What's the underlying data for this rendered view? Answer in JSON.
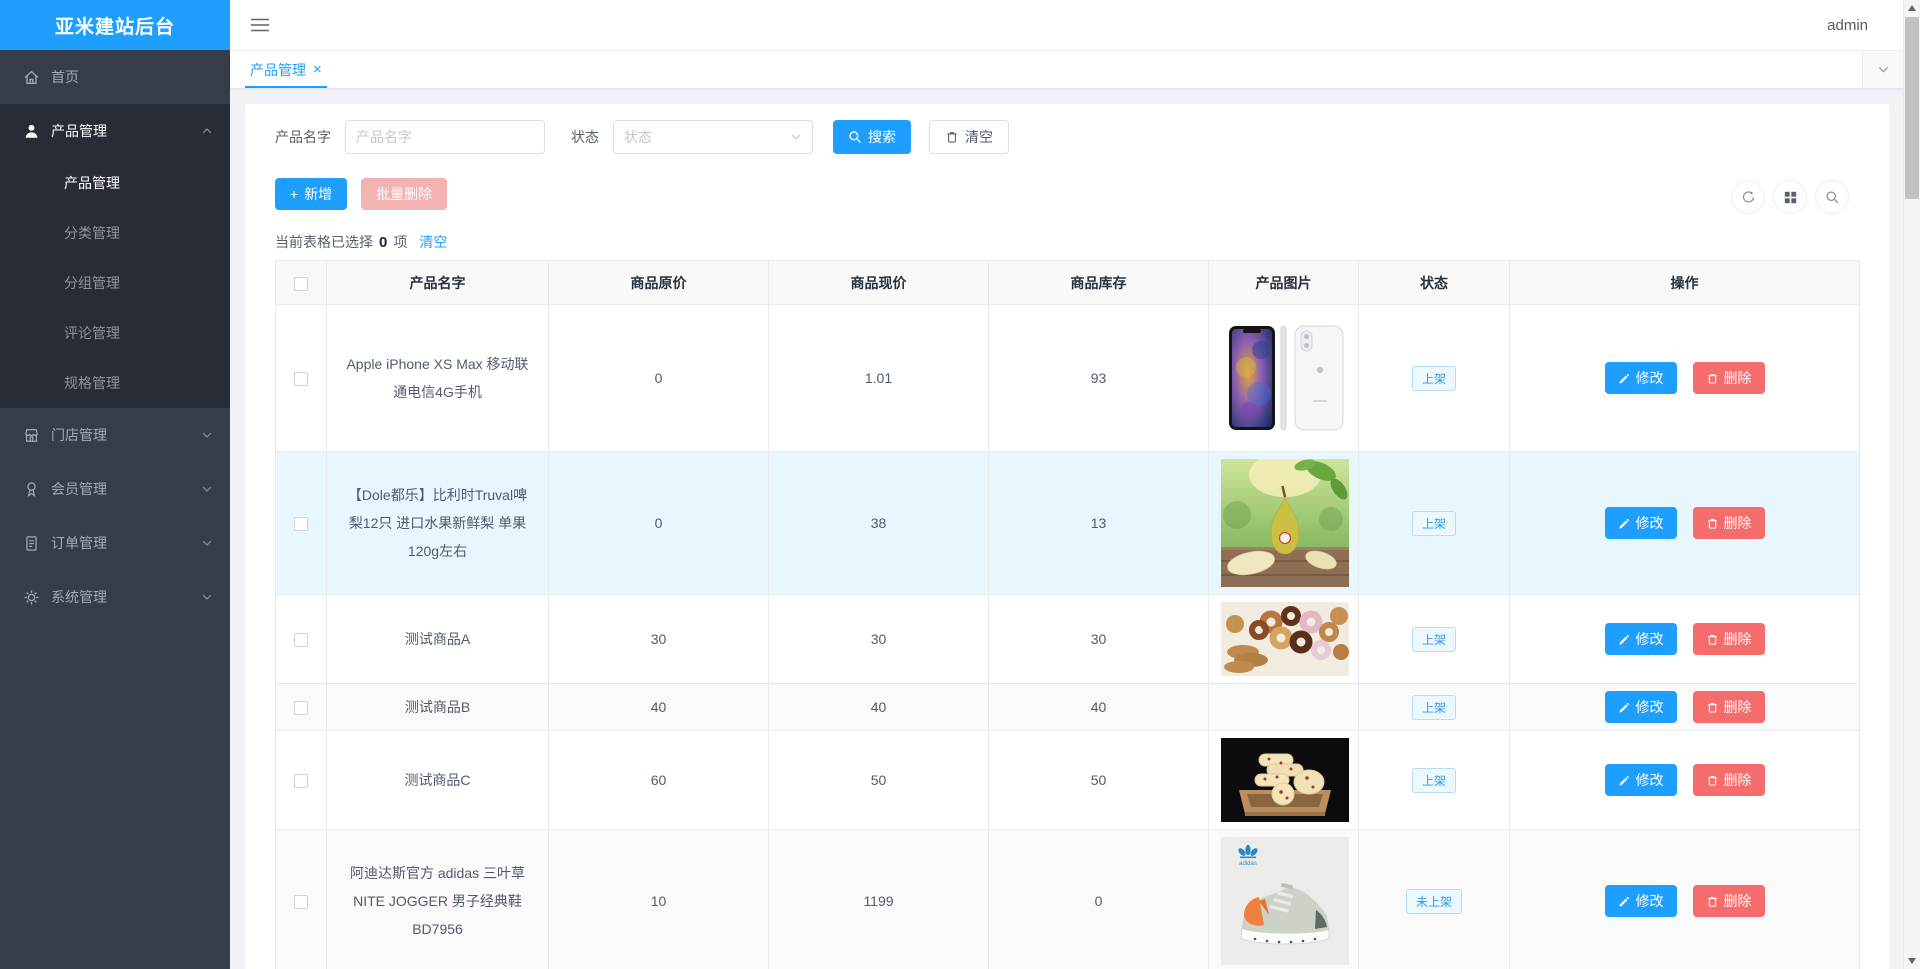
{
  "app": {
    "title": "亚米建站后台",
    "user": "admin"
  },
  "sidebar": {
    "items": [
      {
        "label": "首页",
        "icon": "home-icon"
      },
      {
        "label": "产品管理",
        "icon": "user-icon",
        "expanded": true,
        "children": [
          {
            "label": "产品管理",
            "active": true
          },
          {
            "label": "分类管理"
          },
          {
            "label": "分组管理"
          },
          {
            "label": "评论管理"
          },
          {
            "label": "规格管理"
          }
        ]
      },
      {
        "label": "门店管理",
        "icon": "shop-icon"
      },
      {
        "label": "会员管理",
        "icon": "member-icon"
      },
      {
        "label": "订单管理",
        "icon": "order-icon"
      },
      {
        "label": "系统管理",
        "icon": "gear-icon"
      }
    ]
  },
  "tabbar": {
    "tabs": [
      {
        "label": "产品管理",
        "active": true,
        "closable": true
      }
    ]
  },
  "search": {
    "name_label": "产品名字",
    "name_placeholder": "产品名字",
    "status_label": "状态",
    "status_placeholder": "状态",
    "search_button": "搜索",
    "clear_button": "清空"
  },
  "toolbar": {
    "add_button": "新增",
    "batch_delete_button": "批量删除"
  },
  "selection": {
    "prefix": "当前表格已选择",
    "count": "0",
    "suffix": "项",
    "clear_link": "清空"
  },
  "table": {
    "headers": [
      "产品名字",
      "商品原价",
      "商品现价",
      "商品库存",
      "产品图片",
      "状态",
      "操作"
    ],
    "action_edit": "修改",
    "action_delete": "删除",
    "rows": [
      {
        "name": "Apple iPhone XS Max 移动联通电信4G手机",
        "original_price": "0",
        "current_price": "1.01",
        "stock": "93",
        "image": "iphone",
        "status": "上架"
      },
      {
        "name": "【Dole都乐】比利时Truval啤梨12只 进口水果新鲜梨 单果120g左右",
        "original_price": "0",
        "current_price": "38",
        "stock": "13",
        "image": "pear",
        "status": "上架",
        "highlighted": true
      },
      {
        "name": "测试商品A",
        "original_price": "30",
        "current_price": "30",
        "stock": "30",
        "image": "donuts",
        "status": "上架"
      },
      {
        "name": "测试商品B",
        "original_price": "40",
        "current_price": "40",
        "stock": "40",
        "image": null,
        "status": "上架"
      },
      {
        "name": "测试商品C",
        "original_price": "60",
        "current_price": "50",
        "stock": "50",
        "image": "cookies",
        "status": "上架"
      },
      {
        "name": "阿迪达斯官方 adidas 三叶草 NITE JOGGER 男子经典鞋BD7956",
        "original_price": "10",
        "current_price": "1199",
        "stock": "0",
        "image": "shoe",
        "status": "未上架"
      }
    ]
  },
  "colors": {
    "primary": "#1E9FFF",
    "danger": "#F56C6C",
    "danger_disabled": "#F4B3B3",
    "sidebar_bg": "#363C48",
    "sidebar_submenu_bg": "#272C36",
    "tag_text": "#2F9DE0",
    "tag_bg": "#EDF8FE",
    "content_bg": "#F0F2F5"
  }
}
